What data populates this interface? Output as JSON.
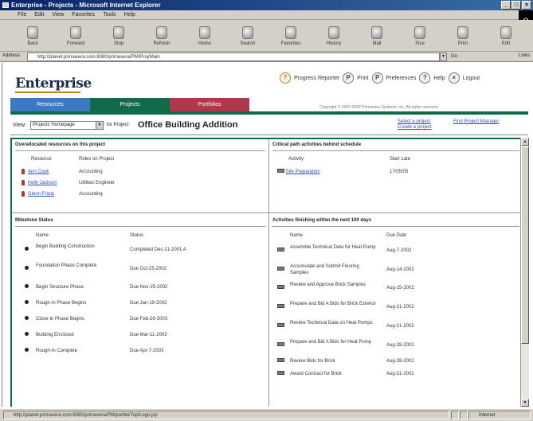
{
  "window": {
    "title": "Enterprise - Projects - Microsoft Internet Explorer",
    "buttons": [
      "_",
      "□",
      "×"
    ]
  },
  "menu": [
    "File",
    "Edit",
    "View",
    "Favorites",
    "Tools",
    "Help"
  ],
  "toolbar": [
    "Back",
    "Forward",
    "Stop",
    "Refresh",
    "Home",
    "Search",
    "Favorites",
    "History",
    "Mail",
    "Size",
    "Print",
    "Edit"
  ],
  "address": {
    "label": "Address",
    "url": "http://planet.primavera.com:8080/primavera/PM/Proj/Main",
    "go": "Go",
    "links": "Links"
  },
  "app": {
    "brand": "Enterprise",
    "toplinks": [
      {
        "icon": "?",
        "label": "Progress Reporter"
      },
      {
        "icon": "P",
        "label": "Print"
      },
      {
        "icon": "P",
        "label": "Preferences"
      },
      {
        "icon": "?",
        "label": "Help"
      },
      {
        "icon": "×",
        "label": "Logout"
      }
    ],
    "tabs": [
      "Resources",
      "Projects",
      "Portfolios"
    ],
    "copyright": "Copyright © 2000-2002 Primavera Systems, Inc. All rights reserved."
  },
  "view": {
    "label": "View:",
    "selected": "Projects Homepage",
    "for_label": "for Project:",
    "project_title": "Office Building Addition",
    "links": [
      "Select a project",
      "Create a project"
    ],
    "link2": "Find Project Manager"
  },
  "resources_panel": {
    "title": "Overallocated resources on this project",
    "col_resource": "Resource",
    "col_role": "Roles on Project",
    "rows": [
      {
        "name": "Ann Cook",
        "role": "Accounting"
      },
      {
        "name": "Kelly Jackson",
        "role": "Utilities Engineer"
      },
      {
        "name": "Glenn Frank",
        "role": "Accounting"
      }
    ]
  },
  "activities_panel": {
    "title": "Critical path activities behind schedule",
    "col_activity": "Activity",
    "col_start": "Start Late",
    "rows": [
      {
        "name": "Site Preparation",
        "start": "17/05/05"
      }
    ]
  },
  "milestones_panel": {
    "title": "Milestone Status",
    "col_name": "Name",
    "col_status": "Status",
    "rows": [
      {
        "name": "Begin Building Construction",
        "status": "Completed Dec-21-2001 A"
      },
      {
        "name": "Foundation Phase Complete",
        "status": "Due Oct-25-2002"
      },
      {
        "name": "Begin Structure Phase",
        "status": "Due Nov-25-2002"
      },
      {
        "name": "Rough-In Phase Begins",
        "status": "Due Jan-19-2003"
      },
      {
        "name": "Close-In Phase Begins",
        "status": "Due Feb-26-2003"
      },
      {
        "name": "Building Enclosed",
        "status": "Due Mar-11-2003"
      },
      {
        "name": "Rough-In Complete",
        "status": "Due Apr-7-2003"
      }
    ]
  },
  "finishing_panel": {
    "title": "Activities finishing within the next 100 days",
    "col_name": "Name",
    "col_due": "Due Date",
    "rows": [
      {
        "name": "Assemble Technical Data for Heat Pump",
        "due": "Aug-7-2002"
      },
      {
        "name": "Accumulate and Submit Flooring Samples",
        "due": "Aug-14-2002"
      },
      {
        "name": "Review and Approve Brick Samples",
        "due": "Aug-15-2002"
      },
      {
        "name": "Prepare and Bid A Bids for Brick Exterior",
        "due": "Aug-21-2002"
      },
      {
        "name": "Review Technical Data on Heat Pumps",
        "due": "Aug-21-2002"
      },
      {
        "name": "Prepare and Bid A Bids for Heat Pump",
        "due": "Aug-28-2002"
      },
      {
        "name": "Review Bids for Brick",
        "due": "Aug-28-2002"
      },
      {
        "name": "Award Contract for Brick",
        "due": "Aug-31-2002"
      }
    ]
  },
  "status": {
    "text": "http://planet.primavera.com:8080/primavera/PM/portlet/Top/Logo.jsp",
    "zone": "Internet"
  }
}
